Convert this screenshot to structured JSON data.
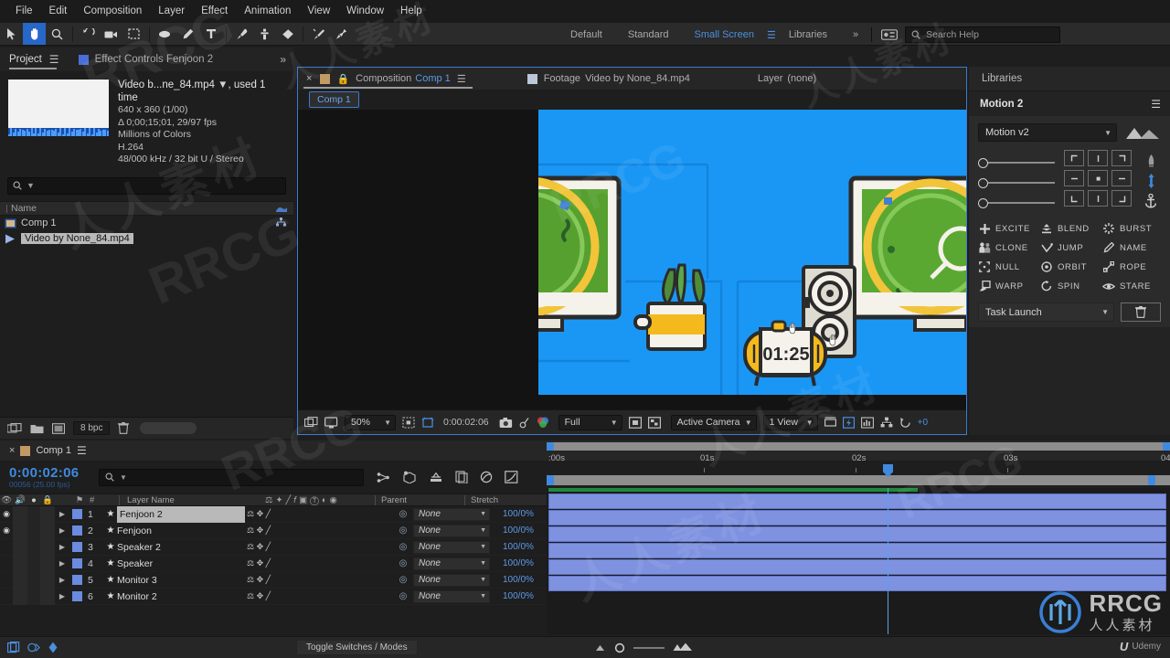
{
  "menu": {
    "items": [
      "File",
      "Edit",
      "Composition",
      "Layer",
      "Effect",
      "Animation",
      "View",
      "Window",
      "Help"
    ]
  },
  "toolbar": {
    "tools": [
      {
        "name": "selection-tool",
        "icon": "arrow"
      },
      {
        "name": "hand-tool",
        "icon": "hand",
        "active": true
      },
      {
        "name": "zoom-tool",
        "icon": "magnifier"
      },
      {
        "name": "rotation-tool",
        "icon": "rotate"
      },
      {
        "name": "camera-tool",
        "icon": "camera"
      },
      {
        "name": "region-of-interest-tool",
        "icon": "roi"
      },
      {
        "name": "shape-tool",
        "icon": "ellipse"
      },
      {
        "name": "pen-tool",
        "icon": "pen"
      },
      {
        "name": "type-tool",
        "icon": "type"
      },
      {
        "name": "brush-tool",
        "icon": "brush"
      },
      {
        "name": "clone-stamp-tool",
        "icon": "stamp"
      },
      {
        "name": "eraser-tool",
        "icon": "eraser"
      },
      {
        "name": "roto-brush-tool",
        "icon": "roto"
      },
      {
        "name": "puppet-pin-tool",
        "icon": "pin"
      }
    ]
  },
  "workspace": {
    "items": [
      "Default",
      "Standard",
      "Small Screen",
      "Libraries"
    ],
    "selected": "Small Screen",
    "overflow": "»",
    "search_placeholder": "Search Help"
  },
  "project": {
    "tab_label": "Project",
    "tab2_label": "Effect Controls Fenjoon 2",
    "overflow": "»",
    "file": {
      "title": "Video b...ne_84.mp4",
      "used": ", used 1 time",
      "dimensions": "640 x 360 (1/00)",
      "duration": "Δ 0;00;15;01, 29/97 fps",
      "colors": "Millions of Colors",
      "codec": "H.264",
      "audio": "48/000 kHz / 32 bit U / Stereo"
    },
    "search_placeholder": "",
    "column_header": "Name",
    "items": [
      {
        "label": "Comp 1",
        "icon": "comp-icon",
        "selected": false
      },
      {
        "label": "Video by None_84.mp4",
        "icon": "footage-icon",
        "selected": true
      }
    ],
    "footer": {
      "bpc_label": "8 bpc"
    }
  },
  "composition": {
    "tabs": [
      {
        "prefix": "Composition",
        "name": "Comp 1",
        "close": "×"
      },
      {
        "prefix": "Footage",
        "name": "Video by None_84.mp4"
      },
      {
        "prefix": "Layer",
        "name": "(none)"
      }
    ],
    "breadcrumb_chip": "Comp 1",
    "toolbar": {
      "magnification": "50%",
      "timecode": "0:00:02:06",
      "resolution": "Full",
      "camera": "Active Camera",
      "views": "1 View",
      "extra": "+0"
    },
    "stage": {
      "background": "#1a97f5",
      "timer_text": "01:25"
    }
  },
  "right_panel": {
    "libraries_tab": "Libraries",
    "motion": {
      "title": "Motion 2",
      "version_select": "Motion v2",
      "buttons": [
        {
          "label": "EXCITE",
          "icon": "plus-icon"
        },
        {
          "label": "BLEND",
          "icon": "blend-icon"
        },
        {
          "label": "BURST",
          "icon": "burst-icon"
        },
        {
          "label": "CLONE",
          "icon": "clone-icon"
        },
        {
          "label": "JUMP",
          "icon": "jump-icon"
        },
        {
          "label": "NAME",
          "icon": "pencil-icon"
        },
        {
          "label": "NULL",
          "icon": "null-icon"
        },
        {
          "label": "ORBIT",
          "icon": "orbit-icon"
        },
        {
          "label": "ROPE",
          "icon": "rope-icon"
        },
        {
          "label": "WARP",
          "icon": "warp-icon"
        },
        {
          "label": "SPIN",
          "icon": "spin-icon"
        },
        {
          "label": "STARE",
          "icon": "eye-icon"
        }
      ],
      "task_launch": "Task Launch"
    }
  },
  "timeline": {
    "tab_label": "Comp 1",
    "current_time": "0:00:02:06",
    "current_frame": "00056 (25.00 fps)",
    "search_placeholder": "",
    "columns": [
      "#",
      "Layer Name",
      "Parent",
      "Stretch"
    ],
    "layers": [
      {
        "index": "1",
        "name": "Fenjoon 2",
        "parent": "None",
        "stretch": "100/0%",
        "selected": true,
        "color": "#6b8be0",
        "visible": true,
        "audio": true
      },
      {
        "index": "2",
        "name": "Fenjoon",
        "parent": "None",
        "stretch": "100/0%",
        "selected": false,
        "color": "#6b8be0",
        "visible": true,
        "audio": true
      },
      {
        "index": "3",
        "name": "Speaker 2",
        "parent": "None",
        "stretch": "100/0%",
        "selected": false,
        "color": "#6b8be0",
        "visible": false,
        "audio": false
      },
      {
        "index": "4",
        "name": "Speaker",
        "parent": "None",
        "stretch": "100/0%",
        "selected": false,
        "color": "#6b8be0",
        "visible": false,
        "audio": false
      },
      {
        "index": "5",
        "name": "Monitor 3",
        "parent": "None",
        "stretch": "100/0%",
        "selected": false,
        "color": "#6b8be0",
        "visible": false,
        "audio": false
      },
      {
        "index": "6",
        "name": "Monitor 2",
        "parent": "None",
        "stretch": "100/0%",
        "selected": false,
        "color": "#6b8be0",
        "visible": false,
        "audio": false
      }
    ],
    "ruler_labels": [
      ":00s",
      "01s",
      "02s",
      "03s",
      "04"
    ],
    "footer": {
      "toggle_switches": "Toggle Switches / Modes"
    }
  },
  "watermark": {
    "text": "RRCG",
    "cn": "人人素材",
    "udemy": "Udemy"
  }
}
